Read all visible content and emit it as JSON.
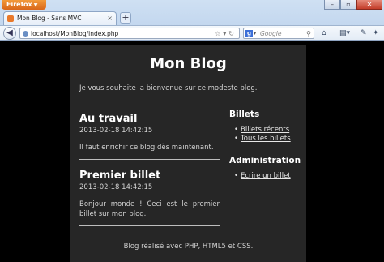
{
  "browser": {
    "app_button": "Firefox",
    "tab_title": "Mon Blog - Sans MVC",
    "new_tab": "+",
    "url": "localhost/MonBlog/index.php",
    "search_placeholder": "Google"
  },
  "blog": {
    "title": "Mon Blog",
    "welcome": "Je vous souhaite la bienvenue sur ce modeste blog.",
    "posts": [
      {
        "title": "Au travail",
        "date": "2013-02-18 14:42:15",
        "body": "Il faut enrichir ce blog dès maintenant."
      },
      {
        "title": "Premier billet",
        "date": "2013-02-18 14:42:15",
        "body": "Bonjour monde ! Ceci est le premier billet sur mon blog."
      }
    ],
    "sidebar": {
      "billets_title": "Billets",
      "billets_links": [
        "Billets récents",
        "Tous les billets"
      ],
      "admin_title": "Administration",
      "admin_links": [
        "Ecrire un billet"
      ]
    },
    "footer": "Blog réalisé avec PHP, HTML5 et CSS."
  }
}
